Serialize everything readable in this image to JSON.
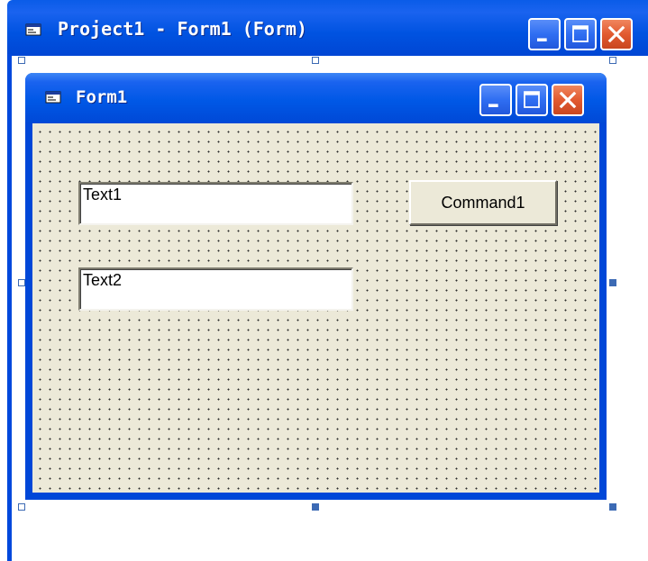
{
  "outer_window": {
    "title": "Project1 - Form1 (Form)",
    "buttons": {
      "minimize": "minimize-icon",
      "maximize": "maximize-icon",
      "close": "close-icon"
    }
  },
  "form": {
    "title": "Form1",
    "buttons": {
      "minimize": "minimize-icon",
      "maximize": "maximize-icon",
      "close": "close-icon"
    },
    "controls": {
      "text1": "Text1",
      "text2": "Text2",
      "command1": "Command1"
    }
  },
  "colors": {
    "titlebar_blue": "#0053e1",
    "client_background": "#ece9d8",
    "close_button": "#e25a30",
    "handle": "#3c6ab4"
  }
}
